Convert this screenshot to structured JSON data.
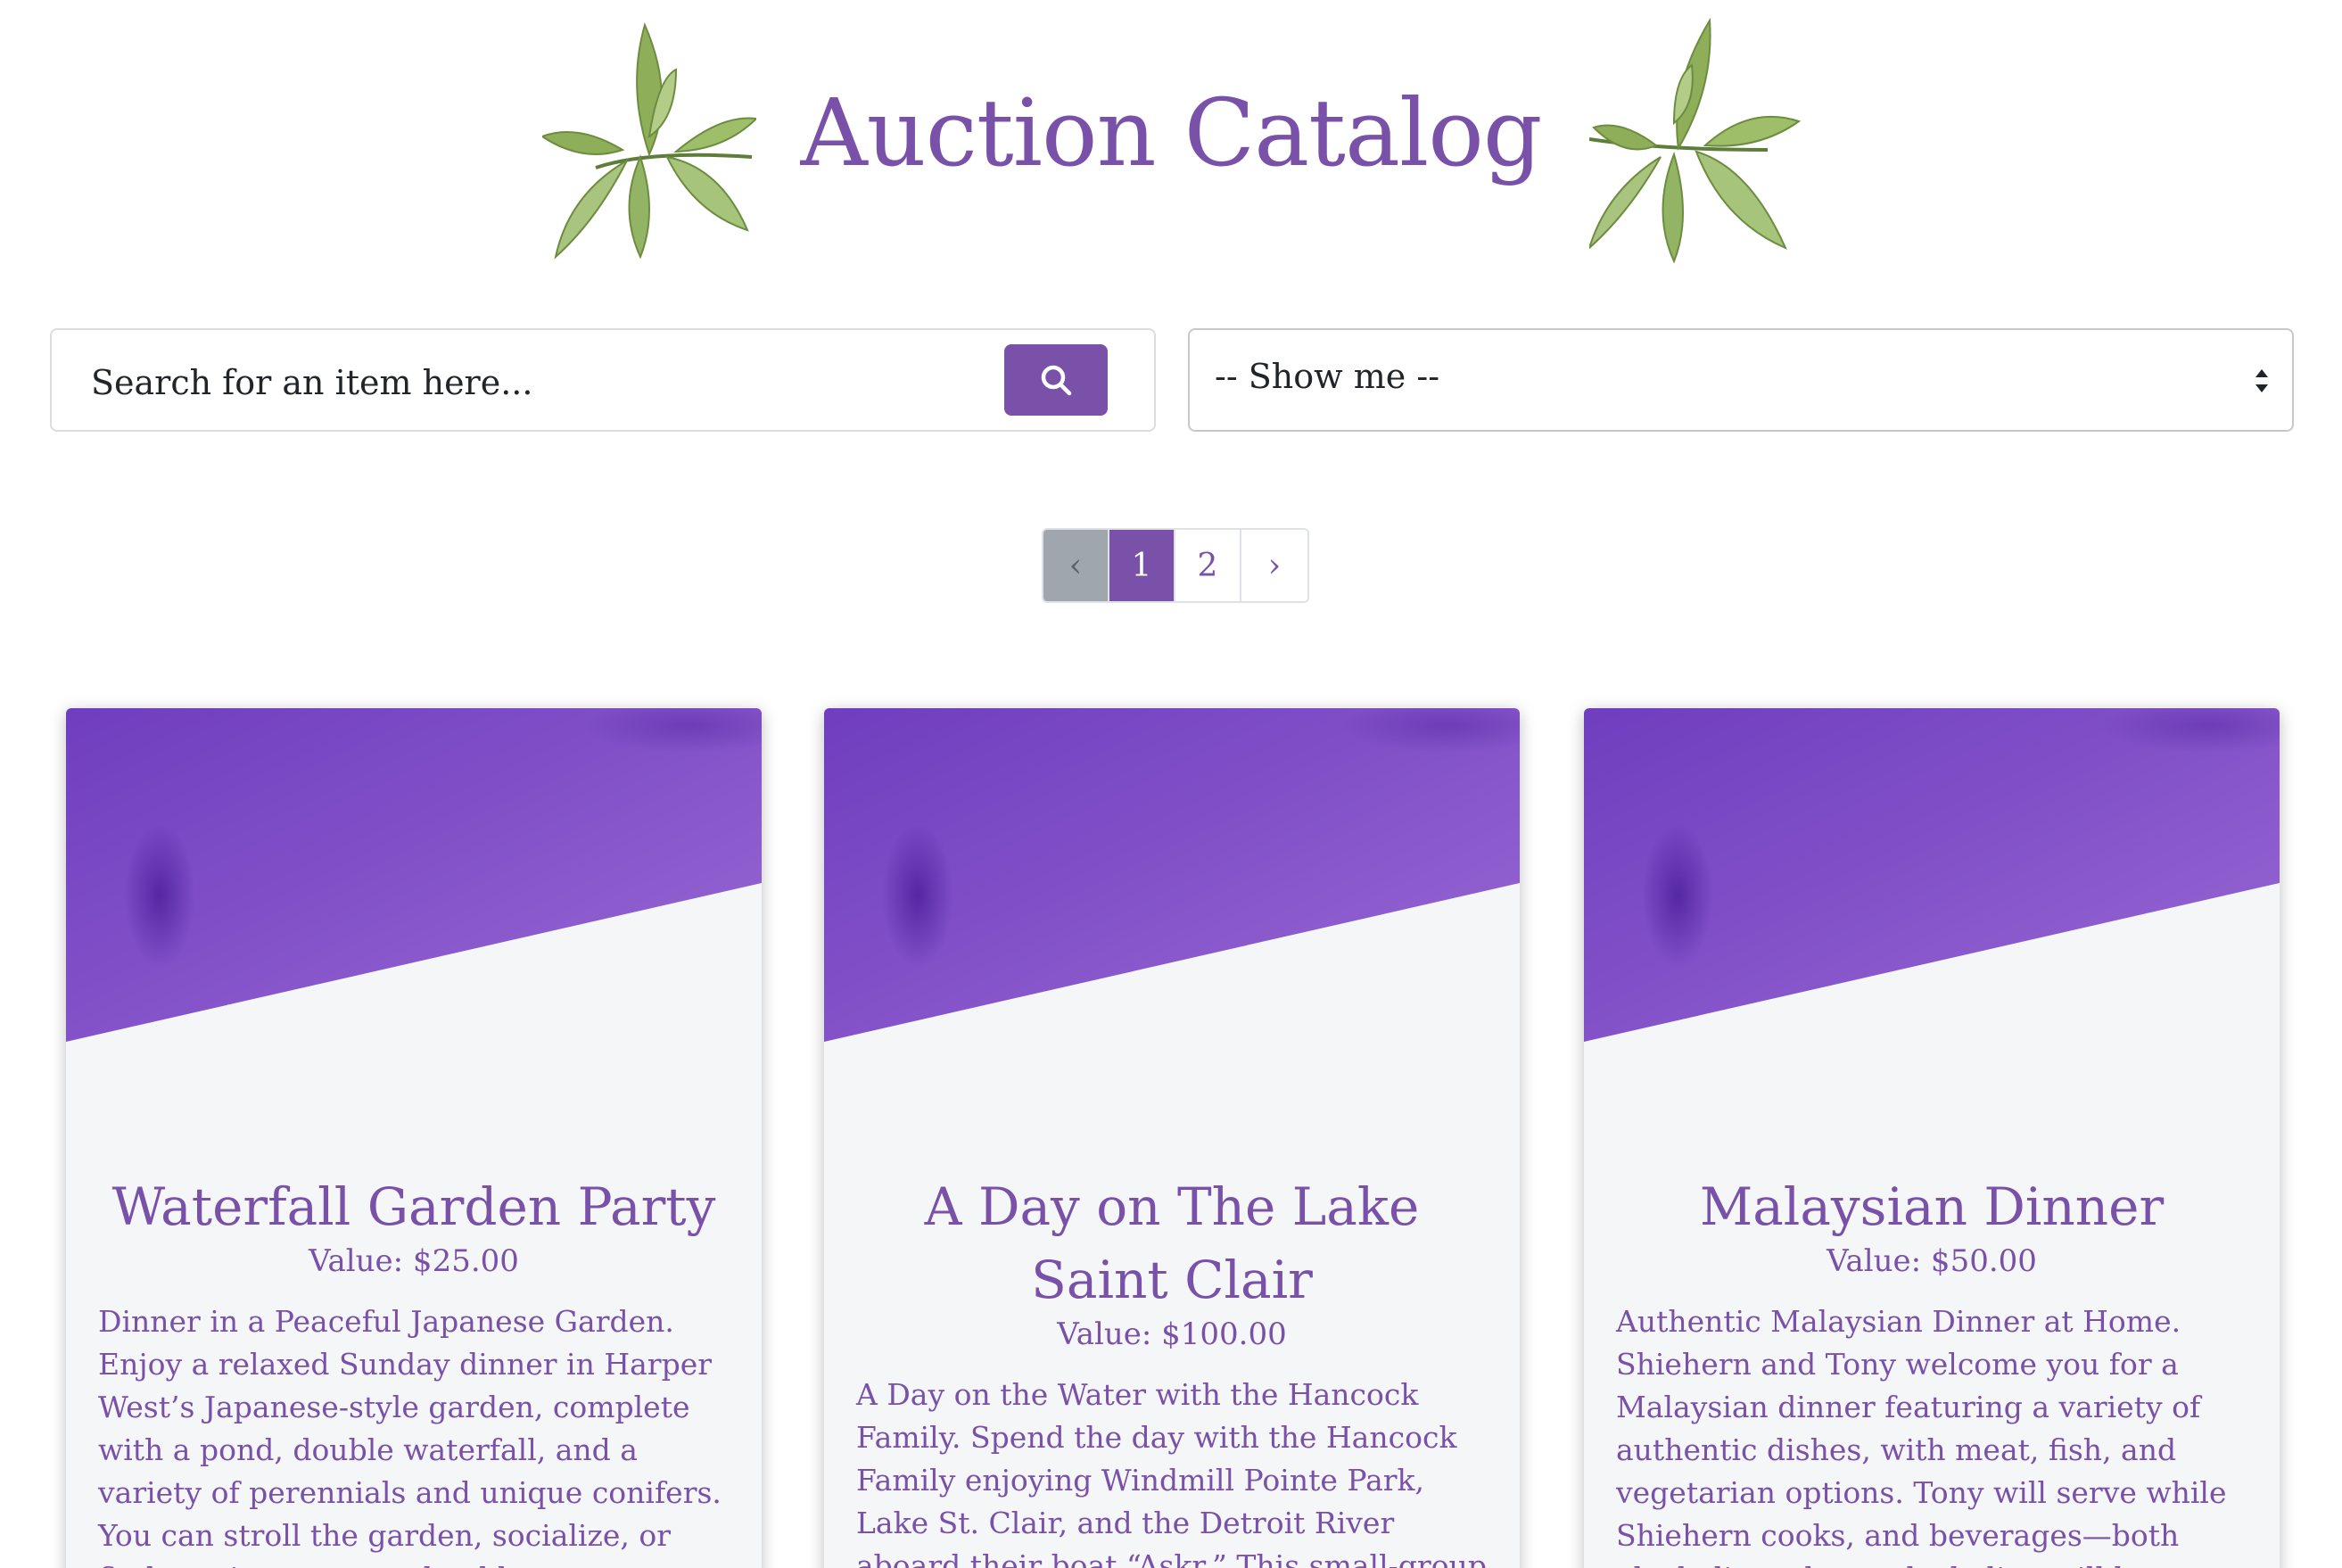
{
  "header": {
    "title": "Auction Catalog"
  },
  "search": {
    "placeholder": "Search for an item here..."
  },
  "filter": {
    "selected": "-- Show me --"
  },
  "pagination": {
    "prev": "‹",
    "pages": [
      "1",
      "2"
    ],
    "active_page": "1",
    "next": "›"
  },
  "colors": {
    "accent": "#7951a9",
    "card_bg": "#f5f6f8",
    "banner_purple": "#7a45c2"
  },
  "cards": [
    {
      "title": "Waterfall Garden Party",
      "value": "Value: $25.00",
      "description": "Dinner in a Peaceful Japanese Garden. Enjoy a relaxed Sunday dinner in Harper West’s Japanese-style garden, complete with a pond, double waterfall, and a variety of perennials and unique conifers. You can stroll the garden, socialize, or find a quiet spot on a boulder to"
    },
    {
      "title": "A Day on The Lake Saint Clair",
      "value": "Value: $100.00",
      "description": "A Day on the Water with the Hancock Family. Spend the day with the Hancock Family enjoying Windmill Pointe Park, Lake St. Clair, and the Detroit River aboard their boat “Askr.” This small-group outing accommodates up to"
    },
    {
      "title": "Malaysian Dinner",
      "value": "Value: $50.00",
      "description": "Authentic Malaysian Dinner at Home. Shiehern and Tony welcome you for a Malaysian dinner featuring a variety of authentic dishes, with meat, fish, and vegetarian options. Tony will serve while Shiehern cooks, and beverages—both alcoholic and non-alcoholic—will be"
    }
  ]
}
